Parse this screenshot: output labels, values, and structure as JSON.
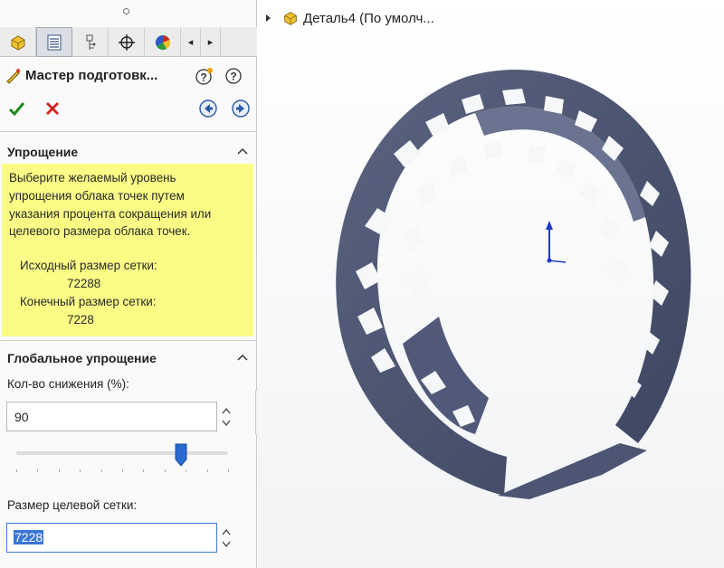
{
  "panel": {
    "title": "Мастер подготовк...",
    "tabs": [
      "feature-manager",
      "property-manager",
      "configuration-manager",
      "dimxpert-manager",
      "display-manager"
    ],
    "tab_nav": [
      "◂",
      "▸"
    ]
  },
  "simplification": {
    "header": "Упрощение",
    "info_lines": [
      "Выберите желаемый уровень",
      "упрощения облака точек путем",
      "указания процента сокращения или",
      "целевого размера облака точек."
    ],
    "source_mesh_label": "Исходный размер сетки:",
    "source_mesh_value": "72288",
    "result_mesh_label": "Конечный размер сетки:",
    "result_mesh_value": "7228"
  },
  "global": {
    "header": "Глобальное упрощение",
    "reduce_label": "Кол-во снижения (%):",
    "reduce_value": "90",
    "slider_percent": 90,
    "target_label": "Размер целевой сетки:",
    "target_value": "7228"
  },
  "viewport": {
    "part_name": "Деталь4  (По умолч..."
  },
  "colors": {
    "info_bg": "#fafc86",
    "accent": "#3a76d8",
    "mesh": "#4a5470"
  }
}
